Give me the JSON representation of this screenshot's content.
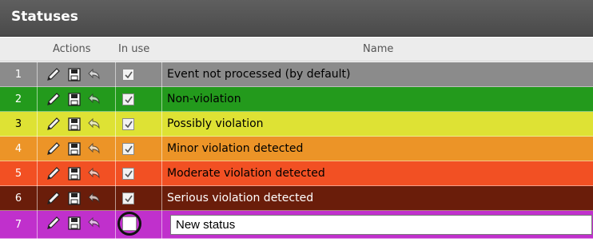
{
  "panel": {
    "title": "Statuses"
  },
  "columns": {
    "actions": "Actions",
    "in_use": "In use",
    "name": "Name"
  },
  "colors": {
    "title_bar": "#525252",
    "header_bg": "#ececec",
    "selection_circle": "#111111"
  },
  "icons": {
    "edit": "pencil-icon",
    "save": "save-icon",
    "undo": "undo-icon",
    "in_use": "checkbox-checked-icon"
  },
  "statuses": [
    {
      "num": "1",
      "name": "Event not processed (by default)",
      "in_use": true,
      "bg": "#8b8b8b",
      "fg": "#000000",
      "numfg": "#ffffff"
    },
    {
      "num": "2",
      "name": "Non-violation",
      "in_use": true,
      "bg": "#239a1c",
      "fg": "#000000",
      "numfg": "#ffffff"
    },
    {
      "num": "3",
      "name": "Possibly violation",
      "in_use": true,
      "bg": "#dee234",
      "fg": "#000000",
      "numfg": "#000000"
    },
    {
      "num": "4",
      "name": "Minor violation detected",
      "in_use": true,
      "bg": "#ec9427",
      "fg": "#000000",
      "numfg": "#ffffff"
    },
    {
      "num": "5",
      "name": "Moderate violation detected",
      "in_use": true,
      "bg": "#f25023",
      "fg": "#000000",
      "numfg": "#ffffff"
    },
    {
      "num": "6",
      "name": "Serious violation detected",
      "in_use": true,
      "bg": "#6a1d0a",
      "fg": "#ffffff",
      "numfg": "#ffffff"
    }
  ],
  "new_status": {
    "num": "7",
    "value": "New status",
    "in_use": false,
    "bg": "#c030cc",
    "numfg": "#ffffff"
  }
}
